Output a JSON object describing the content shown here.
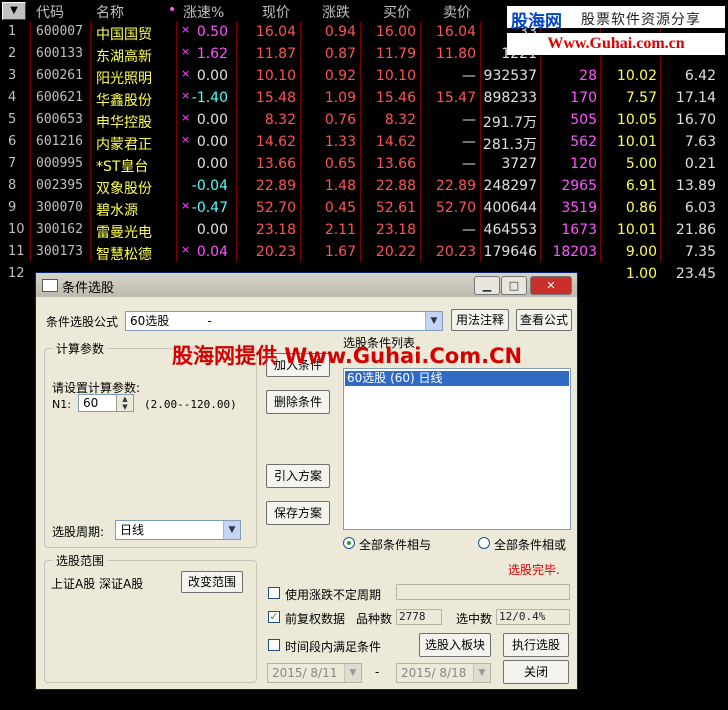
{
  "table": {
    "sort_icon": "▼",
    "headers": [
      "代码",
      "名称",
      "•",
      "涨速%",
      "现价",
      "涨跌",
      "买价",
      "卖价"
    ],
    "rows": [
      {
        "idx": "1",
        "code": "600007",
        "name": "中国国贸",
        "mark": "×",
        "speed": "0.50",
        "price": "16.04",
        "chg": "0.94",
        "bid": "16.00",
        "ask": "16.04",
        "vol": "33",
        "c9": "",
        "c10": "",
        "c11": ""
      },
      {
        "idx": "2",
        "code": "600133",
        "name": "东湖高新",
        "mark": "×",
        "speed": "1.62",
        "price": "11.87",
        "chg": "0.87",
        "bid": "11.79",
        "ask": "11.80",
        "vol": "1221",
        "c9": "",
        "c10": "",
        "c11": ""
      },
      {
        "idx": "3",
        "code": "600261",
        "name": "阳光照明",
        "mark": "×",
        "speed": "0.00",
        "price": "10.10",
        "chg": "0.92",
        "bid": "10.10",
        "ask": "—",
        "vol": "932537",
        "c9": "28",
        "c10": "10.02",
        "c11": "6.42"
      },
      {
        "idx": "4",
        "code": "600621",
        "name": "华鑫股份",
        "mark": "×",
        "speed": "-1.40",
        "price": "15.48",
        "chg": "1.09",
        "bid": "15.46",
        "ask": "15.47",
        "vol": "898233",
        "c9": "170",
        "c10": "7.57",
        "c11": "17.14"
      },
      {
        "idx": "5",
        "code": "600653",
        "name": "申华控股",
        "mark": "×",
        "speed": "0.00",
        "price": "8.32",
        "chg": "0.76",
        "bid": "8.32",
        "ask": "—",
        "vol": "291.7万",
        "c9": "505",
        "c10": "10.05",
        "c11": "16.70"
      },
      {
        "idx": "6",
        "code": "601216",
        "name": "内蒙君正",
        "mark": "×",
        "speed": "0.00",
        "price": "14.62",
        "chg": "1.33",
        "bid": "14.62",
        "ask": "—",
        "vol": "281.3万",
        "c9": "562",
        "c10": "10.01",
        "c11": "7.63"
      },
      {
        "idx": "7",
        "code": "000995",
        "name": "*ST皇台",
        "mark": "",
        "speed": "0.00",
        "price": "13.66",
        "chg": "0.65",
        "bid": "13.66",
        "ask": "—",
        "vol": "3727",
        "c9": "120",
        "c10": "5.00",
        "c11": "0.21"
      },
      {
        "idx": "8",
        "code": "002395",
        "name": "双象股份",
        "mark": "",
        "speed": "-0.04",
        "price": "22.89",
        "chg": "1.48",
        "bid": "22.88",
        "ask": "22.89",
        "vol": "248297",
        "c9": "2965",
        "c10": "6.91",
        "c11": "13.89"
      },
      {
        "idx": "9",
        "code": "300070",
        "name": "碧水源",
        "mark": "×",
        "speed": "-0.47",
        "price": "52.70",
        "chg": "0.45",
        "bid": "52.61",
        "ask": "52.70",
        "vol": "400644",
        "c9": "3519",
        "c10": "0.86",
        "c11": "6.03"
      },
      {
        "idx": "10",
        "code": "300162",
        "name": "雷曼光电",
        "mark": "",
        "speed": "0.00",
        "price": "23.18",
        "chg": "2.11",
        "bid": "23.18",
        "ask": "—",
        "vol": "464553",
        "c9": "1673",
        "c10": "10.01",
        "c11": "21.86"
      },
      {
        "idx": "11",
        "code": "300173",
        "name": "智慧松德",
        "mark": "×",
        "speed": "0.04",
        "price": "20.23",
        "chg": "1.67",
        "bid": "20.22",
        "ask": "20.23",
        "vol": "179646",
        "c9": "18203",
        "c10": "9.00",
        "c11": "7.35"
      },
      {
        "idx": "12",
        "code": "",
        "name": "",
        "mark": "",
        "speed": "",
        "price": "",
        "chg": "",
        "bid": "",
        "ask": "",
        "vol": "",
        "c9": "",
        "c10": "1.00",
        "c11": "23.45"
      }
    ]
  },
  "watermark": {
    "brand": "股海网",
    "slogan": "股票软件资源分享",
    "url": "Www.Guhai.com.cn"
  },
  "overlay_text": "股海网提供 Www.Guhai.Com.CN",
  "dialog": {
    "title": "条件选股",
    "formula_label": "条件选股公式",
    "formula_value": "60选股          -",
    "usage_button": "用法注释",
    "view_formula_button": "查看公式",
    "params_group": "计算参数",
    "params_prompt": "请设置计算参数:",
    "n1_label": "N1:",
    "n1_value": "60",
    "n1_range": "(2.00--120.00)",
    "period_label": "选股周期:",
    "period_value": "日线",
    "add_button": "加入条件",
    "delete_button": "删除条件",
    "import_button": "引入方案",
    "save_button": "保存方案",
    "list_title": "选股条件列表",
    "list_items": [
      "60选股 (60) 日线"
    ],
    "radio_and": "全部条件相与",
    "radio_or": "全部条件相或",
    "status": "选股完毕.",
    "scope_group": "选股范围",
    "scope_value": "上证A股 深证A股",
    "change_scope_button": "改变范围",
    "use_period_label": "使用涨跌不定周期",
    "prerights_label": "前复权数据",
    "count_label": "品种数",
    "count_value": "2778",
    "selected_label": "选中数",
    "selected_value": "12/0.4%",
    "time_range_label": "时间段内满足条件",
    "to_block_button": "选股入板块",
    "execute_button": "执行选股",
    "start_date": "2015/ 8/11",
    "date_sep": "-",
    "end_date": "2015/ 8/18",
    "close_button": "关闭"
  },
  "colors": {
    "up": "#ff5454",
    "down": "#54ff54",
    "name": "#ffff54",
    "volume_alt": "#ff54ff"
  }
}
